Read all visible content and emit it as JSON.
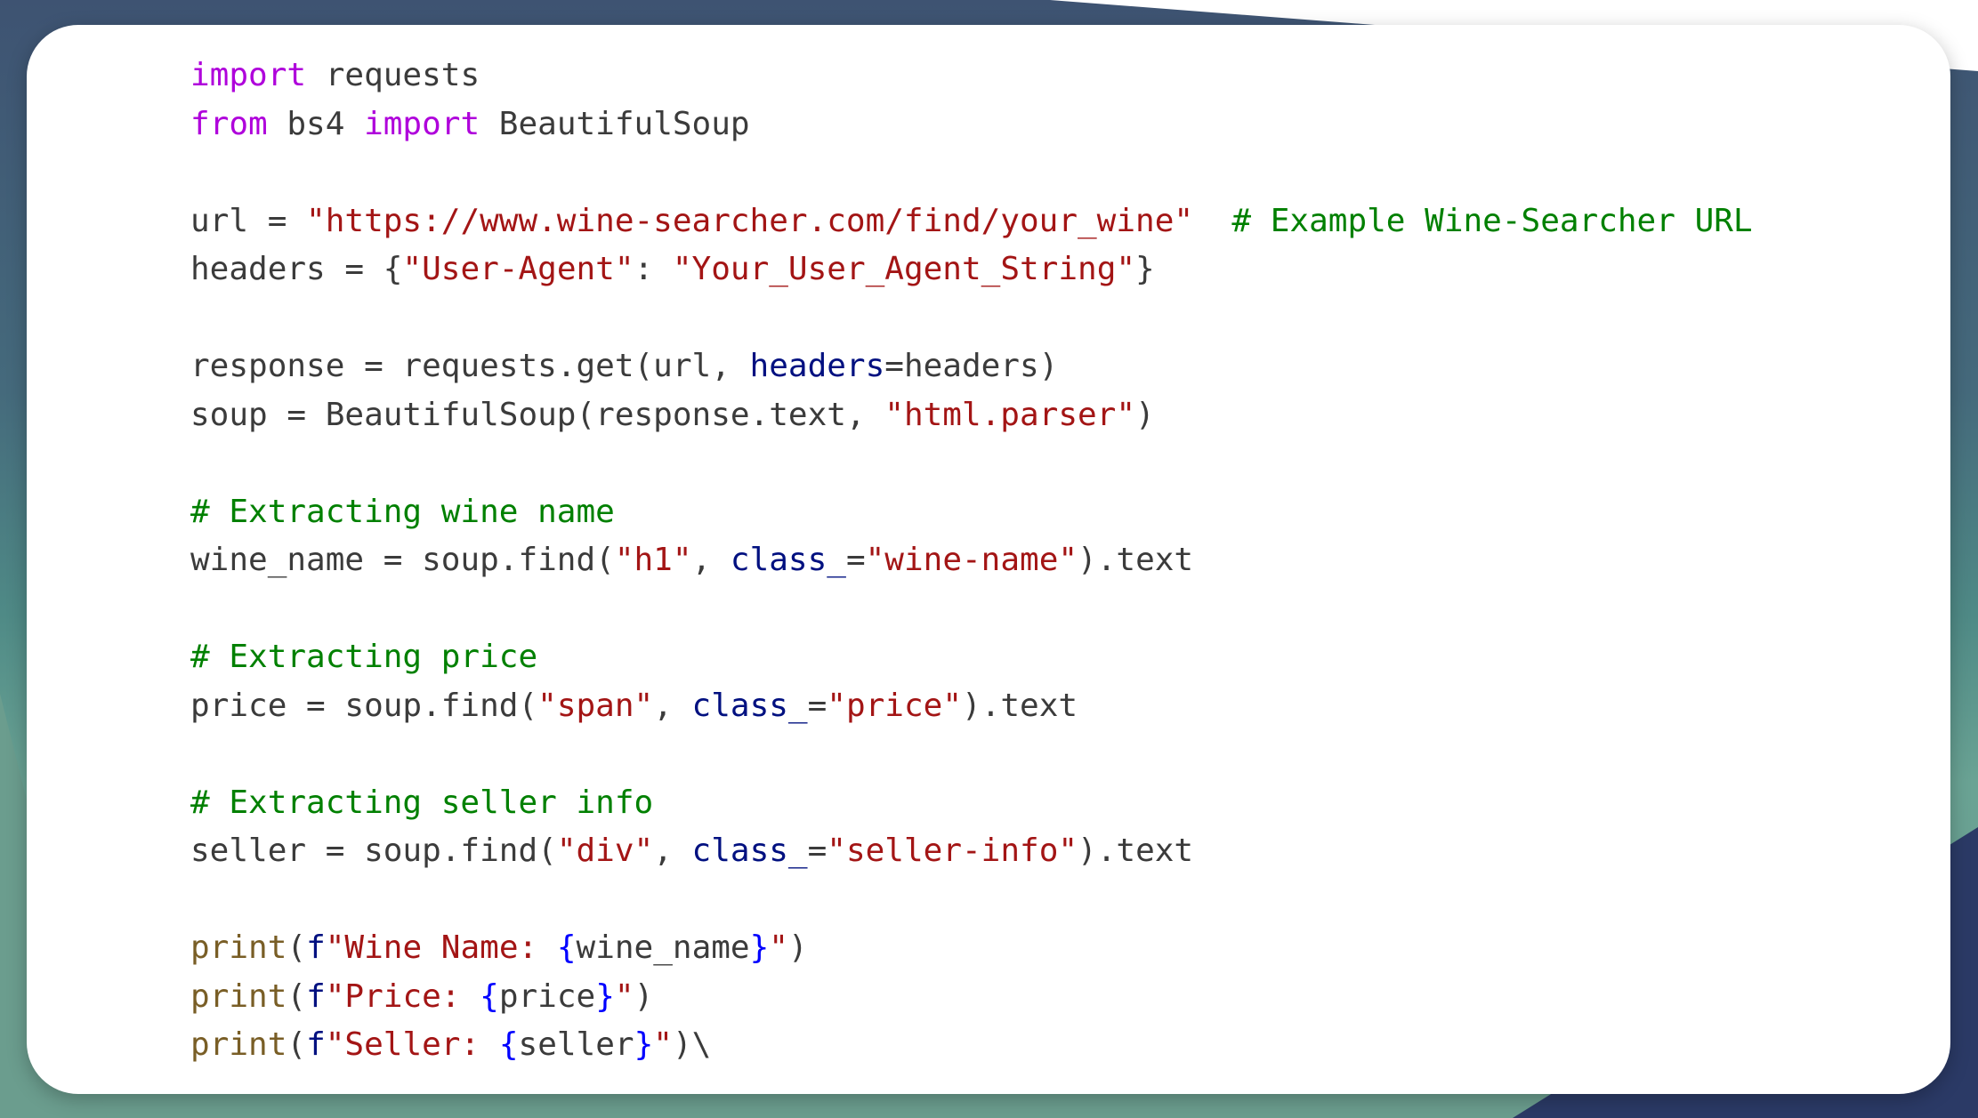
{
  "colors": {
    "keyword": "#af00db",
    "string": "#a31515",
    "comment": "#008000",
    "parameter": "#001080",
    "function": "#795e26",
    "brace": "#0000ff",
    "text": "#3b3b3b",
    "card_background": "#ffffff",
    "background_top": "#3e5372",
    "background_teal": "#6aa394",
    "background_navy": "#2b3a66"
  },
  "code": {
    "language": "python",
    "lines": [
      [
        {
          "t": "kw",
          "v": "import"
        },
        {
          "t": "plain",
          "v": " requests"
        }
      ],
      [
        {
          "t": "kw",
          "v": "from"
        },
        {
          "t": "plain",
          "v": " bs4 "
        },
        {
          "t": "kw",
          "v": "import"
        },
        {
          "t": "plain",
          "v": " BeautifulSoup"
        }
      ],
      [],
      [
        {
          "t": "plain",
          "v": "url = "
        },
        {
          "t": "str",
          "v": "\"https://www.wine-searcher.com/find/your_wine\""
        },
        {
          "t": "plain",
          "v": "  "
        },
        {
          "t": "cmt",
          "v": "# Example Wine-Searcher URL"
        }
      ],
      [
        {
          "t": "plain",
          "v": "headers = {"
        },
        {
          "t": "str",
          "v": "\"User-Agent\""
        },
        {
          "t": "plain",
          "v": ": "
        },
        {
          "t": "str",
          "v": "\"Your_User_Agent_String\""
        },
        {
          "t": "plain",
          "v": "}"
        }
      ],
      [],
      [
        {
          "t": "plain",
          "v": "response = requests.get(url, "
        },
        {
          "t": "param",
          "v": "headers"
        },
        {
          "t": "plain",
          "v": "=headers)"
        }
      ],
      [
        {
          "t": "plain",
          "v": "soup = BeautifulSoup(response.text, "
        },
        {
          "t": "str",
          "v": "\"html.parser\""
        },
        {
          "t": "plain",
          "v": ")"
        }
      ],
      [],
      [
        {
          "t": "cmt",
          "v": "# Extracting wine name"
        }
      ],
      [
        {
          "t": "plain",
          "v": "wine_name = soup.find("
        },
        {
          "t": "str",
          "v": "\"h1\""
        },
        {
          "t": "plain",
          "v": ", "
        },
        {
          "t": "param",
          "v": "class_"
        },
        {
          "t": "plain",
          "v": "="
        },
        {
          "t": "str",
          "v": "\"wine-name\""
        },
        {
          "t": "plain",
          "v": ").text"
        }
      ],
      [],
      [
        {
          "t": "cmt",
          "v": "# Extracting price"
        }
      ],
      [
        {
          "t": "plain",
          "v": "price = soup.find("
        },
        {
          "t": "str",
          "v": "\"span\""
        },
        {
          "t": "plain",
          "v": ", "
        },
        {
          "t": "param",
          "v": "class_"
        },
        {
          "t": "plain",
          "v": "="
        },
        {
          "t": "str",
          "v": "\"price\""
        },
        {
          "t": "plain",
          "v": ").text"
        }
      ],
      [],
      [
        {
          "t": "cmt",
          "v": "# Extracting seller info"
        }
      ],
      [
        {
          "t": "plain",
          "v": "seller = soup.find("
        },
        {
          "t": "str",
          "v": "\"div\""
        },
        {
          "t": "plain",
          "v": ", "
        },
        {
          "t": "param",
          "v": "class_"
        },
        {
          "t": "plain",
          "v": "="
        },
        {
          "t": "str",
          "v": "\"seller-info\""
        },
        {
          "t": "plain",
          "v": ").text"
        }
      ],
      [],
      [
        {
          "t": "fn",
          "v": "print"
        },
        {
          "t": "plain",
          "v": "("
        },
        {
          "t": "param",
          "v": "f"
        },
        {
          "t": "str",
          "v": "\"Wine Name: "
        },
        {
          "t": "brace",
          "v": "{"
        },
        {
          "t": "plain",
          "v": "wine_name"
        },
        {
          "t": "brace",
          "v": "}"
        },
        {
          "t": "str",
          "v": "\""
        },
        {
          "t": "plain",
          "v": ")"
        }
      ],
      [
        {
          "t": "fn",
          "v": "print"
        },
        {
          "t": "plain",
          "v": "("
        },
        {
          "t": "param",
          "v": "f"
        },
        {
          "t": "str",
          "v": "\"Price: "
        },
        {
          "t": "brace",
          "v": "{"
        },
        {
          "t": "plain",
          "v": "price"
        },
        {
          "t": "brace",
          "v": "}"
        },
        {
          "t": "str",
          "v": "\""
        },
        {
          "t": "plain",
          "v": ")"
        }
      ],
      [
        {
          "t": "fn",
          "v": "print"
        },
        {
          "t": "plain",
          "v": "("
        },
        {
          "t": "param",
          "v": "f"
        },
        {
          "t": "str",
          "v": "\"Seller: "
        },
        {
          "t": "brace",
          "v": "{"
        },
        {
          "t": "plain",
          "v": "seller"
        },
        {
          "t": "brace",
          "v": "}"
        },
        {
          "t": "str",
          "v": "\""
        },
        {
          "t": "plain",
          "v": ")\\"
        }
      ]
    ]
  }
}
